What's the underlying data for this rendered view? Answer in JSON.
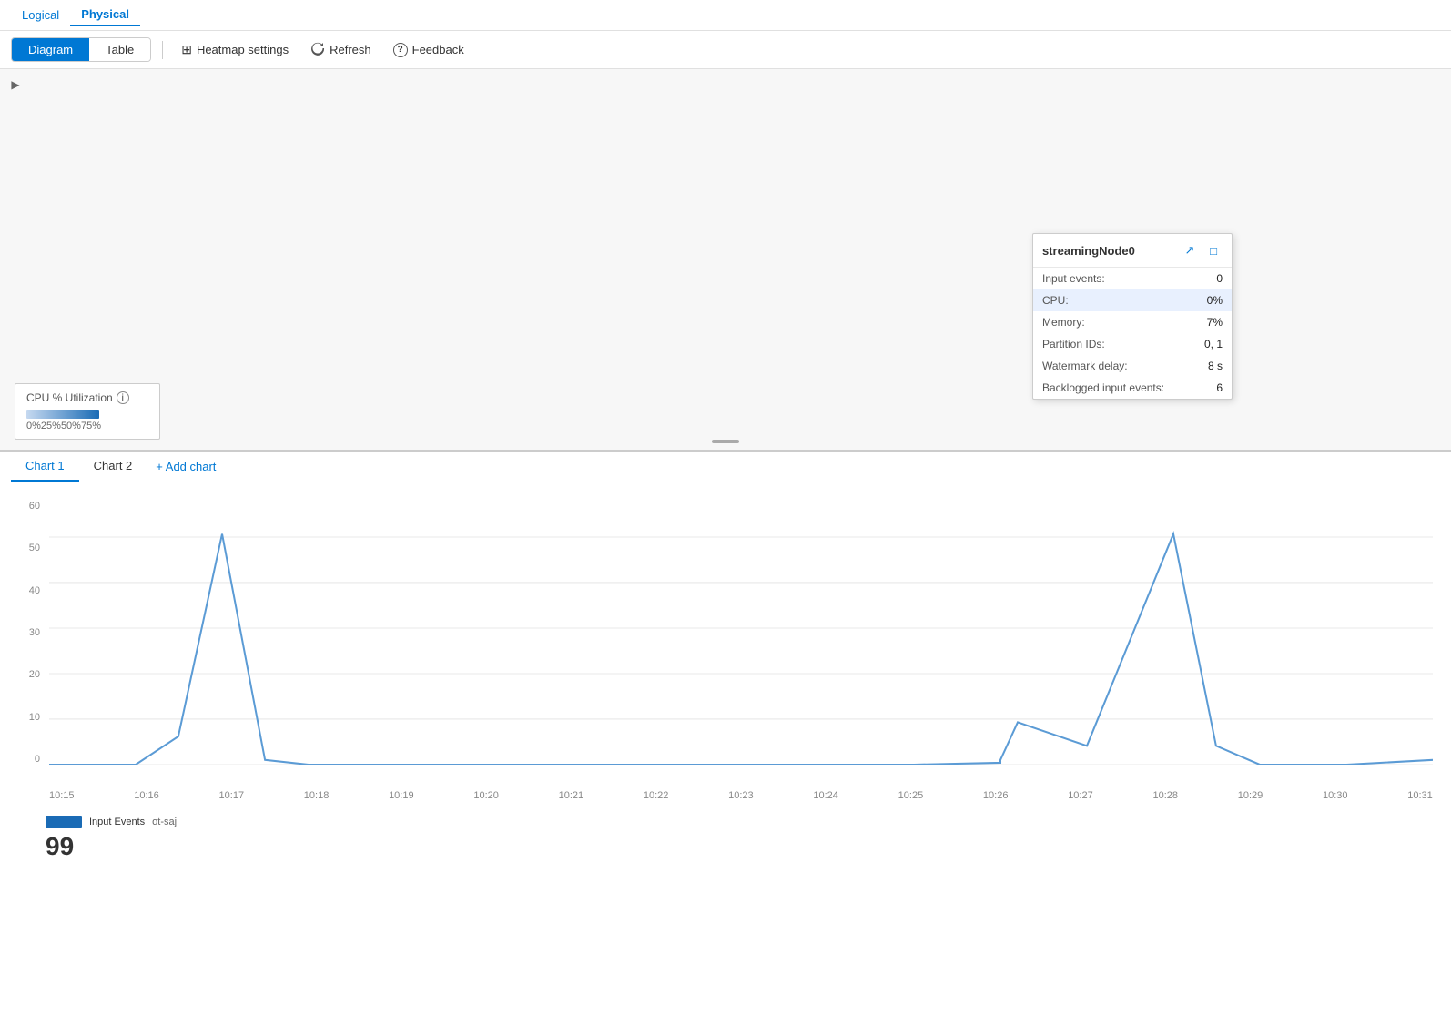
{
  "topTabs": {
    "tabs": [
      "Logical",
      "Physical"
    ],
    "active": "Physical"
  },
  "toolbar": {
    "viewToggle": {
      "options": [
        "Diagram",
        "Table"
      ],
      "active": "Diagram"
    },
    "heatmapSettings": "Heatmap settings",
    "refresh": "Refresh",
    "feedback": "Feedback"
  },
  "diagram": {
    "expandIcon": "▶"
  },
  "legend": {
    "title": "CPU % Utilization",
    "infoIcon": "ℹ",
    "scaleLabels": [
      "0%",
      "25%",
      "50%",
      "75%"
    ]
  },
  "nodeCard": {
    "name": "streamingNode0",
    "linkIcon": "↗",
    "expandIcon": "□",
    "rows": [
      {
        "label": "Input events:",
        "value": "0",
        "highlighted": false
      },
      {
        "label": "CPU:",
        "value": "0%",
        "highlighted": true
      },
      {
        "label": "Memory:",
        "value": "7%",
        "highlighted": false
      },
      {
        "label": "Partition IDs:",
        "value": "0, 1",
        "highlighted": false
      },
      {
        "label": "Watermark delay:",
        "value": "8 s",
        "highlighted": false
      },
      {
        "label": "Backlogged input events:",
        "value": "6",
        "highlighted": false
      }
    ]
  },
  "chartTabs": {
    "tabs": [
      "Chart 1",
      "Chart 2"
    ],
    "active": "Chart 1",
    "addLabel": "+ Add chart"
  },
  "chart": {
    "yLabels": [
      "60",
      "50",
      "40",
      "30",
      "20",
      "10",
      "0"
    ],
    "xLabels": [
      "10:15",
      "10:16",
      "10:17",
      "10:18",
      "10:19",
      "10:20",
      "10:21",
      "10:22",
      "10:23",
      "10:24",
      "10:25",
      "10:26",
      "10:27",
      "10:28",
      "10:29",
      "10:30",
      "10:31"
    ],
    "legendLabel": "Input Events",
    "legendSublabel": "ot-saj",
    "currentValue": "99",
    "lineColor": "#5b9bd5"
  }
}
